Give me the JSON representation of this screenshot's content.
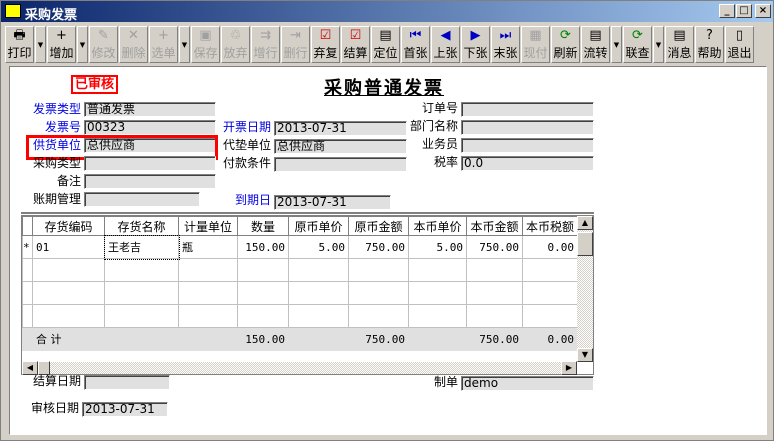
{
  "window": {
    "title": "采购发票",
    "min": "_",
    "max": "□",
    "close": "×"
  },
  "toolbar": [
    {
      "label": "打印",
      "icon": "🖶",
      "enabled": true,
      "dropdown": true
    },
    {
      "label": "增加",
      "icon": "+",
      "enabled": true,
      "dropdown": true
    },
    {
      "label": "修改",
      "icon": "✎",
      "enabled": false
    },
    {
      "label": "删除",
      "icon": "✕",
      "enabled": false
    },
    {
      "label": "选单",
      "icon": "+",
      "enabled": false,
      "dropdown": true
    },
    {
      "label": "保存",
      "icon": "▣",
      "enabled": false
    },
    {
      "label": "放弃",
      "icon": "♲",
      "enabled": false
    },
    {
      "label": "增行",
      "icon": "⇉",
      "enabled": false
    },
    {
      "label": "删行",
      "icon": "⇥",
      "enabled": false
    },
    {
      "label": "弃复",
      "icon": "☑",
      "enabled": true
    },
    {
      "label": "结算",
      "icon": "☑",
      "enabled": true
    },
    {
      "label": "定位",
      "icon": "▤",
      "enabled": true
    },
    {
      "label": "首张",
      "icon": "⏮",
      "enabled": true
    },
    {
      "label": "上张",
      "icon": "◀",
      "enabled": true
    },
    {
      "label": "下张",
      "icon": "▶",
      "enabled": true
    },
    {
      "label": "末张",
      "icon": "⏭",
      "enabled": true
    },
    {
      "label": "现付",
      "icon": "▦",
      "enabled": false
    },
    {
      "label": "刷新",
      "icon": "⟳",
      "enabled": true
    },
    {
      "label": "流转",
      "icon": "▤",
      "enabled": true,
      "dropdown": true
    },
    {
      "label": "联查",
      "icon": "⟳",
      "enabled": true,
      "dropdown": true
    },
    {
      "label": "消息",
      "icon": "▤",
      "enabled": true
    },
    {
      "label": "帮助",
      "icon": "?",
      "enabled": true
    },
    {
      "label": "退出",
      "icon": "▯",
      "enabled": true
    }
  ],
  "form": {
    "status_stamp": "已审核",
    "title": "采购普通发票",
    "invoice_type": {
      "label": "发票类型",
      "value": "普通发票"
    },
    "invoice_no": {
      "label": "发票号",
      "value": "00323"
    },
    "supplier": {
      "label": "供货单位",
      "value": "总供应商"
    },
    "purchase_type": {
      "label": "采购类型",
      "value": ""
    },
    "remark": {
      "label": "备注",
      "value": ""
    },
    "period_mgmt": {
      "label": "账期管理",
      "value": ""
    },
    "invoice_date": {
      "label": "开票日期",
      "value": "2013-07-31"
    },
    "agent_unit": {
      "label": "代垫单位",
      "value": "总供应商"
    },
    "payment_terms": {
      "label": "付款条件",
      "value": ""
    },
    "due_date": {
      "label": "到期日",
      "value": "2013-07-31"
    },
    "order_no": {
      "label": "订单号",
      "value": ""
    },
    "department": {
      "label": "部门名称",
      "value": ""
    },
    "salesman": {
      "label": "业务员",
      "value": ""
    },
    "tax_rate": {
      "label": "税率",
      "value": "0.0"
    },
    "settle_date": {
      "label": "结算日期",
      "value": ""
    },
    "audit_date": {
      "label": "审核日期",
      "value": "2013-07-31"
    },
    "maker": {
      "label": "制单",
      "value": "demo"
    }
  },
  "grid": {
    "columns": [
      "存货编码",
      "存货名称",
      "计量单位",
      "数量",
      "原币单价",
      "原币金额",
      "本币单价",
      "本币金额",
      "本币税额"
    ],
    "rows": [
      [
        "01",
        "王老吉",
        "瓶",
        "150.00",
        "5.00",
        "750.00",
        "5.00",
        "750.00",
        "0.00"
      ]
    ],
    "row_marker": "*",
    "summary": {
      "label": "合  计",
      "qty": "150.00",
      "orig_amount": "750.00",
      "local_amount": "750.00",
      "local_tax": "0.00"
    }
  },
  "colors": {
    "accent_blue": "#0000e0",
    "stamp_red": "#ff0000"
  }
}
